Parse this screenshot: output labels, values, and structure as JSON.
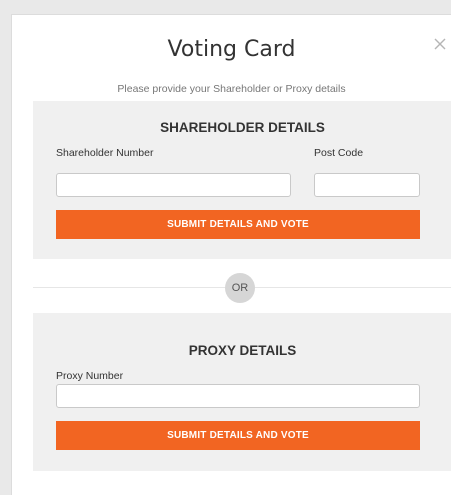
{
  "modal": {
    "title": "Voting Card",
    "subtitle": "Please provide your Shareholder or Proxy details",
    "close_icon": "close-icon"
  },
  "shareholder": {
    "heading": "SHAREHOLDER DETAILS",
    "number_label": "Shareholder Number",
    "number_value": "",
    "postcode_label": "Post Code",
    "postcode_value": "",
    "submit_label": "SUBMIT DETAILS AND VOTE"
  },
  "divider": {
    "label": "OR"
  },
  "proxy": {
    "heading": "PROXY DETAILS",
    "number_label": "Proxy Number",
    "number_value": "",
    "submit_label": "SUBMIT DETAILS AND VOTE"
  },
  "colors": {
    "accent": "#f26522",
    "panel_bg": "#f0f0f0",
    "page_bg": "#e9e9e9"
  }
}
